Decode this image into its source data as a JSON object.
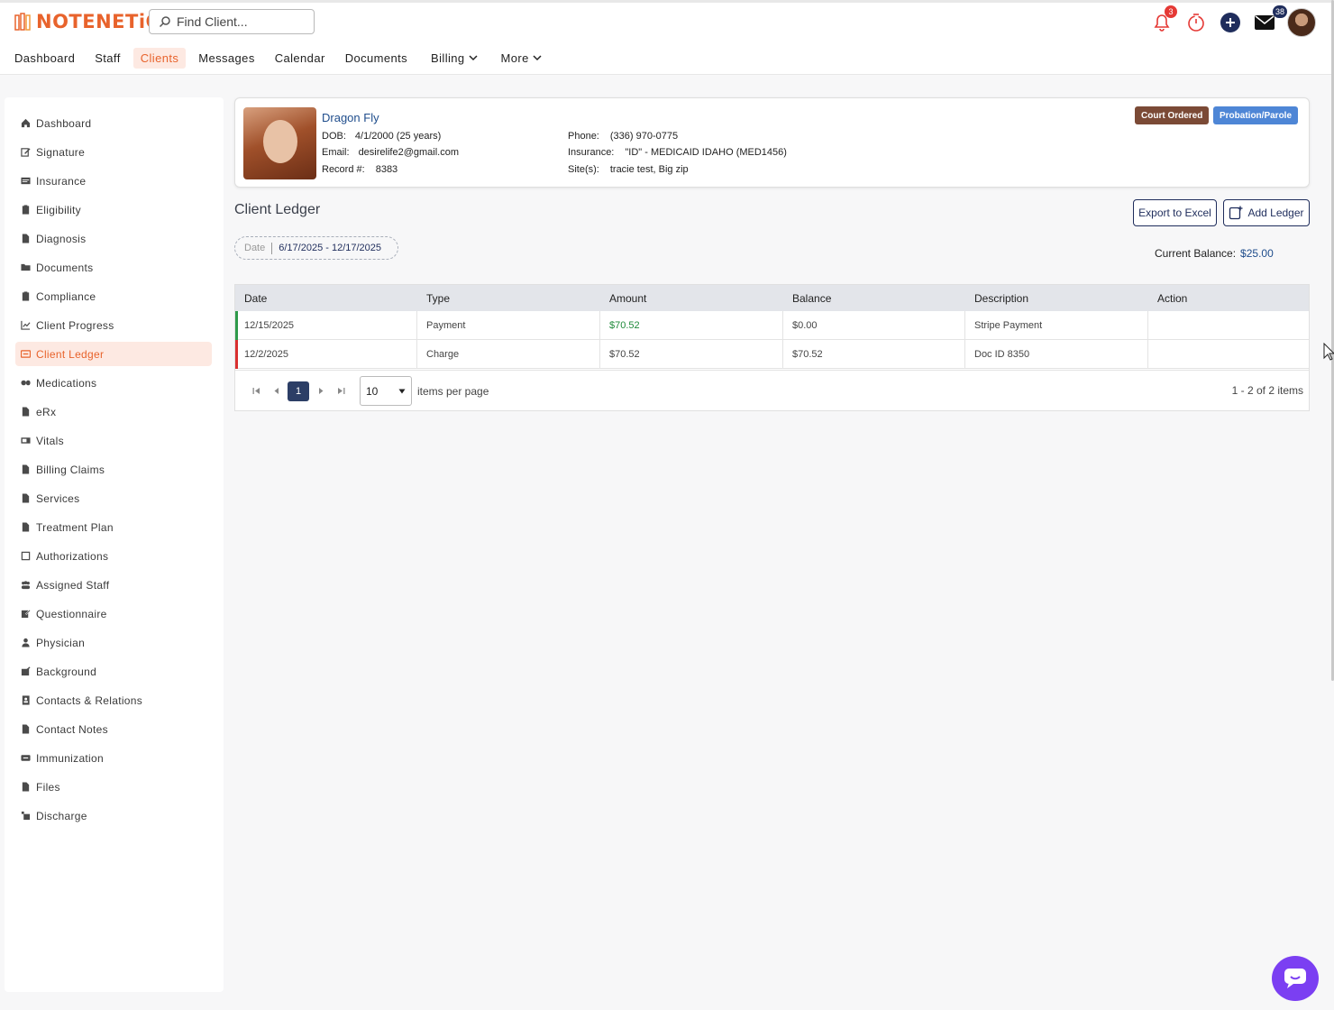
{
  "app": {
    "logo_text": "NOTENETiC",
    "search_placeholder": "Find Client...",
    "notification_count": "3",
    "mail_count": "38"
  },
  "nav": {
    "items": [
      {
        "label": "Dashboard",
        "active": false,
        "dropdown": false
      },
      {
        "label": "Staff",
        "active": false,
        "dropdown": false
      },
      {
        "label": "Clients",
        "active": true,
        "dropdown": false
      },
      {
        "label": "Messages",
        "active": false,
        "dropdown": false
      },
      {
        "label": "Calendar",
        "active": false,
        "dropdown": false
      },
      {
        "label": "Documents",
        "active": false,
        "dropdown": false
      },
      {
        "label": "Billing",
        "active": false,
        "dropdown": true
      },
      {
        "label": "More",
        "active": false,
        "dropdown": true
      }
    ]
  },
  "sidebar": {
    "items": [
      {
        "label": "Dashboard",
        "icon": "home-icon"
      },
      {
        "label": "Signature",
        "icon": "signature-icon"
      },
      {
        "label": "Insurance",
        "icon": "insurance-icon"
      },
      {
        "label": "Eligibility",
        "icon": "clipboard-icon"
      },
      {
        "label": "Diagnosis",
        "icon": "file-icon"
      },
      {
        "label": "Documents",
        "icon": "folder-icon"
      },
      {
        "label": "Compliance",
        "icon": "clipboard-icon"
      },
      {
        "label": "Client Progress",
        "icon": "chart-line-icon"
      },
      {
        "label": "Client Ledger",
        "icon": "ledger-icon",
        "active": true
      },
      {
        "label": "Medications",
        "icon": "pills-icon"
      },
      {
        "label": "eRx",
        "icon": "file-icon"
      },
      {
        "label": "Vitals",
        "icon": "vitals-icon"
      },
      {
        "label": "Billing Claims",
        "icon": "file-icon"
      },
      {
        "label": "Services",
        "icon": "file-icon"
      },
      {
        "label": "Treatment Plan",
        "icon": "file-icon"
      },
      {
        "label": "Authorizations",
        "icon": "check-square-icon"
      },
      {
        "label": "Assigned Staff",
        "icon": "users-icon"
      },
      {
        "label": "Questionnaire",
        "icon": "edit-icon"
      },
      {
        "label": "Physician",
        "icon": "user-doctor-icon"
      },
      {
        "label": "Background",
        "icon": "background-icon"
      },
      {
        "label": "Contacts & Relations",
        "icon": "address-book-icon"
      },
      {
        "label": "Contact Notes",
        "icon": "file-icon"
      },
      {
        "label": "Immunization",
        "icon": "immunization-icon"
      },
      {
        "label": "Files",
        "icon": "file-icon"
      },
      {
        "label": "Discharge",
        "icon": "discharge-icon"
      }
    ]
  },
  "client": {
    "name": "Dragon Fly",
    "dob_label": "DOB:",
    "dob": "4/1/2000 (25 years)",
    "email_label": "Email:",
    "email": "desirelife2@gmail.com",
    "record_label": "Record #:",
    "record": "8383",
    "phone_label": "Phone:",
    "phone": "(336) 970-0775",
    "insurance_label": "Insurance:",
    "insurance": "\"ID\" - MEDICAID IDAHO (MED1456)",
    "sites_label": "Site(s):",
    "sites": "tracie test, Big zip",
    "tags": [
      "Court Ordered",
      "Probation/Parole"
    ]
  },
  "ledger": {
    "title": "Client Ledger",
    "export_label": "Export to Excel",
    "add_label": "Add Ledger",
    "date_label": "Date",
    "date_range": "6/17/2025 - 12/17/2025",
    "balance_label": "Current Balance:",
    "balance_value": "$25.00",
    "columns": [
      "Date",
      "Type",
      "Amount",
      "Balance",
      "Description",
      "Action"
    ],
    "rows": [
      {
        "date": "12/15/2025",
        "type": "Payment",
        "amount": "$70.52",
        "balance": "$0.00",
        "description": "Stripe Payment",
        "action": "",
        "bar_color": "#2e9a4a",
        "amount_color": "green"
      },
      {
        "date": "12/2/2025",
        "type": "Charge",
        "amount": "$70.52",
        "balance": "$70.52",
        "description": "Doc ID 8350",
        "action": "",
        "bar_color": "#d93030",
        "amount_color": "default"
      }
    ],
    "pager": {
      "page": "1",
      "page_size": "10",
      "items_label": "items per page",
      "count_label": "1 - 2 of 2 items"
    }
  },
  "colors": {
    "accent": "#e8632c",
    "navy": "#1f2d5c",
    "link": "#1f4d8c",
    "chat": "#7b3ff2"
  }
}
